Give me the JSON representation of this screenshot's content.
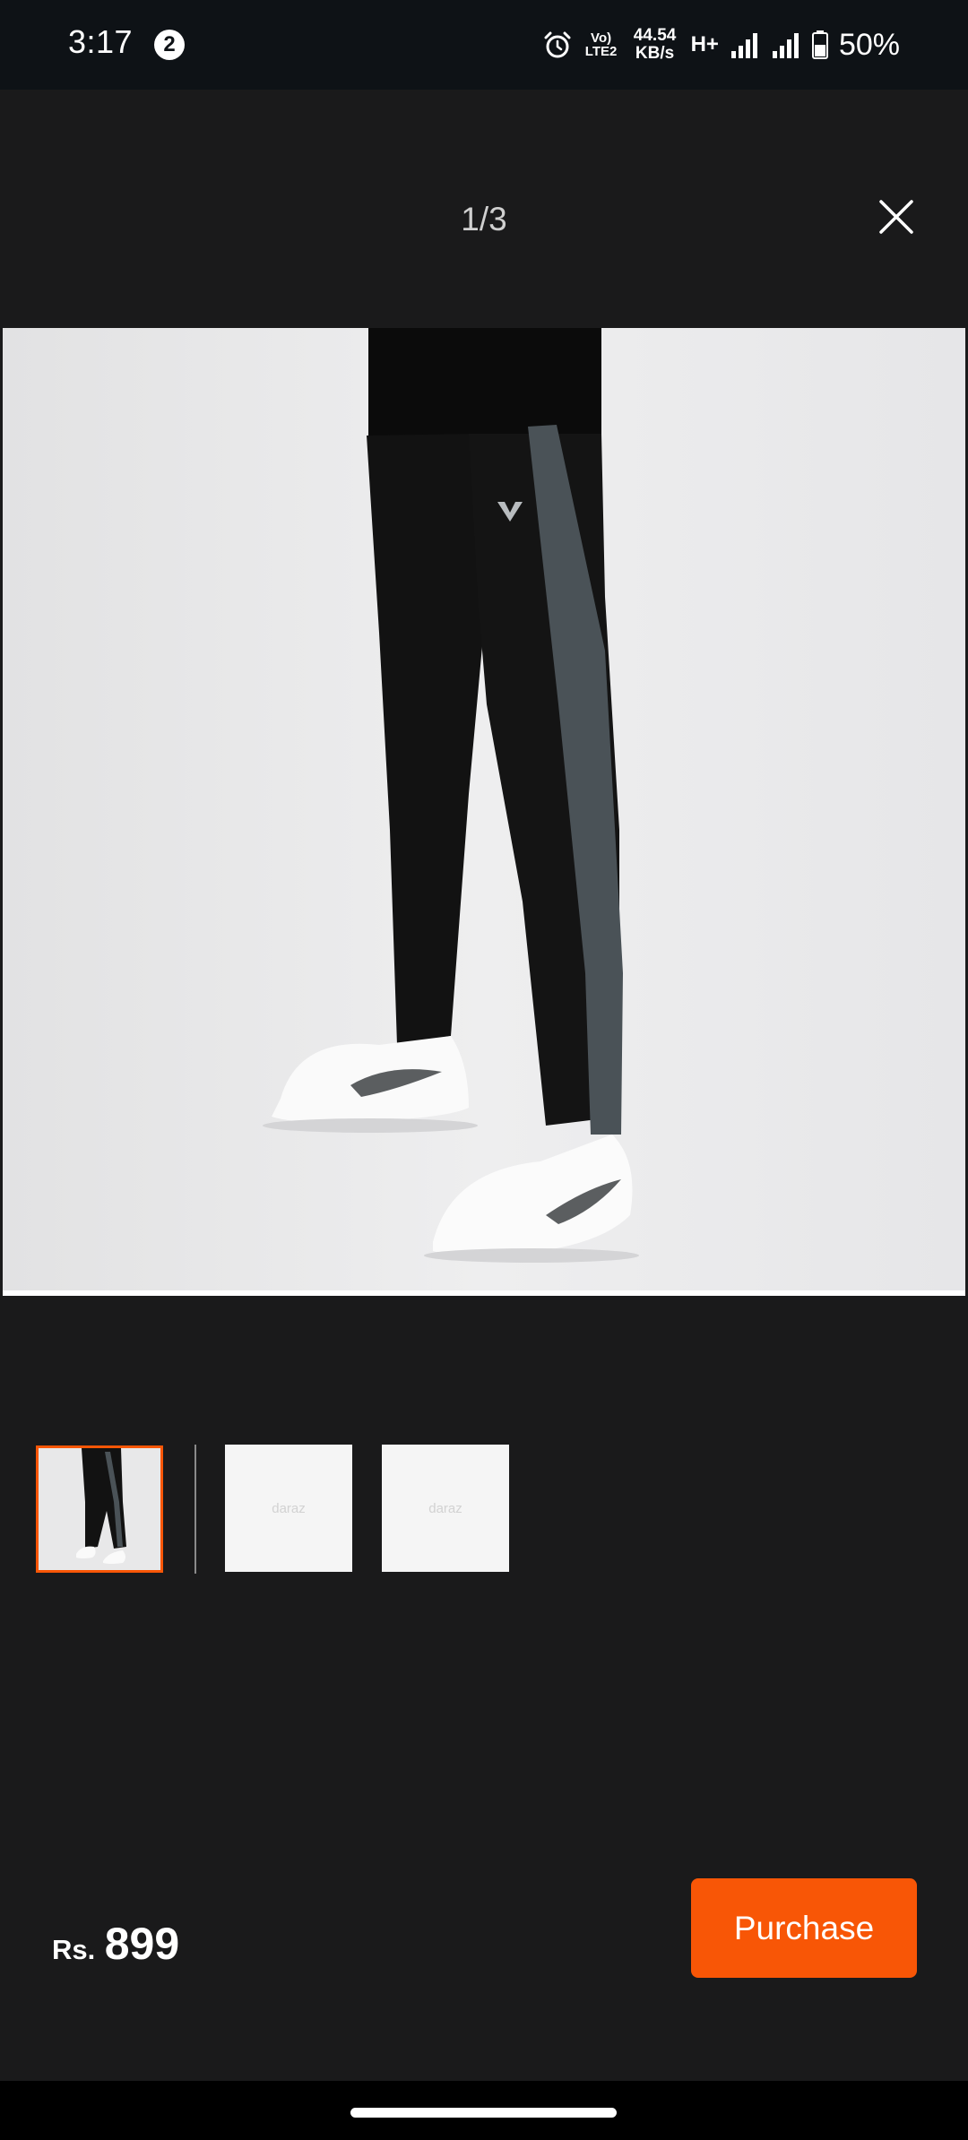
{
  "status_bar": {
    "time": "3:17",
    "notification_count": "2",
    "volte_top": "Vo)",
    "volte_bottom": "LTE2",
    "net_speed_value": "44.54",
    "net_speed_unit": "KB/s",
    "network_type": "H+",
    "battery_percent": "50%"
  },
  "header": {
    "page_indicator": "1/3"
  },
  "thumbnails": [
    {
      "placeholder": ""
    },
    {
      "placeholder": "daraz"
    },
    {
      "placeholder": "daraz"
    }
  ],
  "footer": {
    "currency": "Rs.",
    "price": "899",
    "purchase_label": "Purchase"
  },
  "colors": {
    "accent": "#f85606",
    "background": "#1a1a1b",
    "status_bar": "#0e1216"
  },
  "icons": {
    "close": "close-icon",
    "alarm": "alarm-icon",
    "signal": "signal-icon",
    "battery": "battery-icon"
  }
}
